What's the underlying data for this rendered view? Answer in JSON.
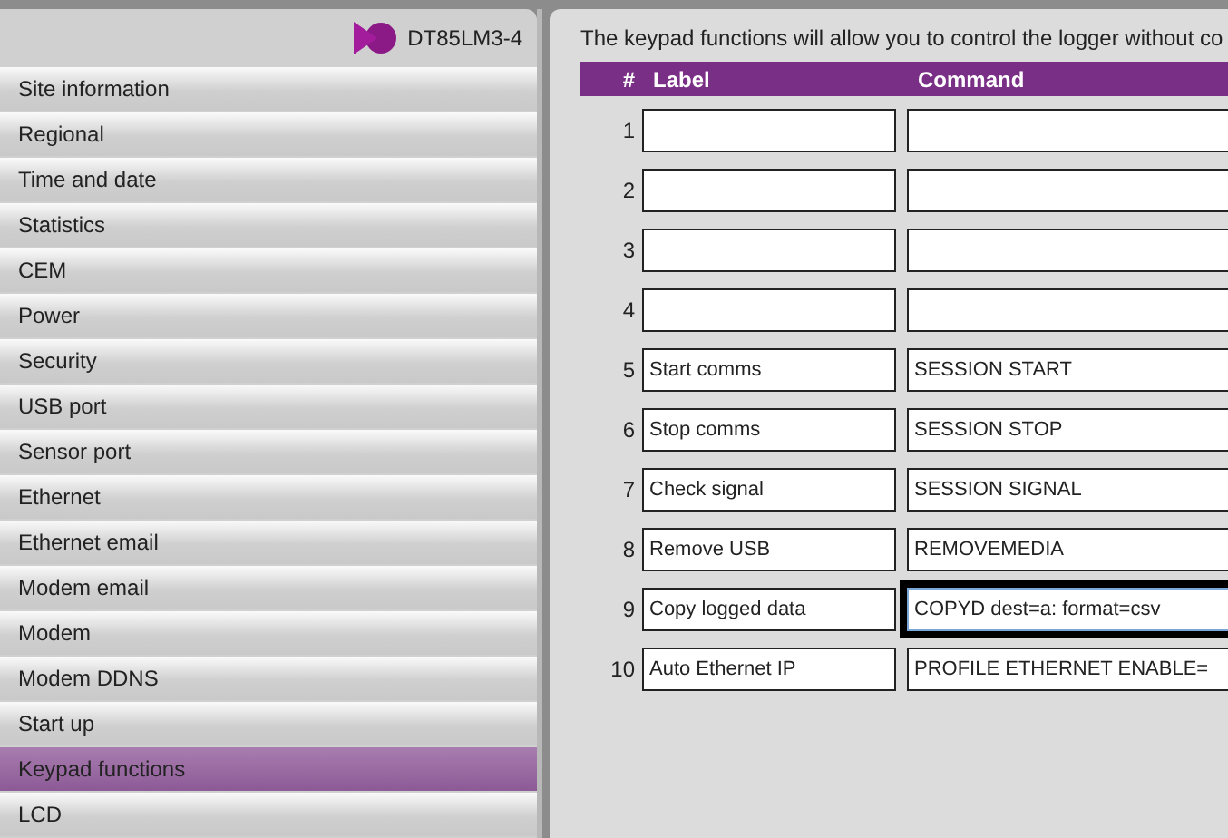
{
  "device": {
    "name": "DT85LM3-4"
  },
  "sidebar": {
    "items": [
      {
        "label": "Site information",
        "selected": false
      },
      {
        "label": "Regional",
        "selected": false
      },
      {
        "label": "Time and date",
        "selected": false
      },
      {
        "label": "Statistics",
        "selected": false
      },
      {
        "label": "CEM",
        "selected": false
      },
      {
        "label": "Power",
        "selected": false
      },
      {
        "label": "Security",
        "selected": false
      },
      {
        "label": "USB port",
        "selected": false
      },
      {
        "label": "Sensor port",
        "selected": false
      },
      {
        "label": "Ethernet",
        "selected": false
      },
      {
        "label": "Ethernet email",
        "selected": false
      },
      {
        "label": "Modem email",
        "selected": false
      },
      {
        "label": "Modem",
        "selected": false
      },
      {
        "label": "Modem DDNS",
        "selected": false
      },
      {
        "label": "Start up",
        "selected": false
      },
      {
        "label": "Keypad functions",
        "selected": true
      },
      {
        "label": "LCD",
        "selected": false
      }
    ]
  },
  "intro": "The keypad functions will allow you to control the logger without co",
  "table": {
    "columns": [
      "#",
      "Label",
      "Command"
    ],
    "rows": [
      {
        "number": "1",
        "focused": false
      },
      {
        "number": "2",
        "focused": false
      },
      {
        "number": "3",
        "focused": false
      },
      {
        "number": "4",
        "focused": false
      },
      {
        "number": "5",
        "label": "Start comms",
        "command": "SESSION START",
        "focused": false
      },
      {
        "number": "6",
        "label": "Stop comms",
        "command": "SESSION STOP",
        "focused": false
      },
      {
        "number": "7",
        "label": "Check signal",
        "command": "SESSION SIGNAL",
        "focused": false
      },
      {
        "number": "8",
        "label": "Remove USB",
        "command": "REMOVEMEDIA",
        "focused": false
      },
      {
        "number": "9",
        "label": "Copy logged data",
        "command": "COPYD dest=a: format=csv",
        "focused": true
      },
      {
        "number": "10",
        "label": "Auto Ethernet IP",
        "command": "PROFILE ETHERNET ENABLE=",
        "focused": false
      }
    ]
  }
}
